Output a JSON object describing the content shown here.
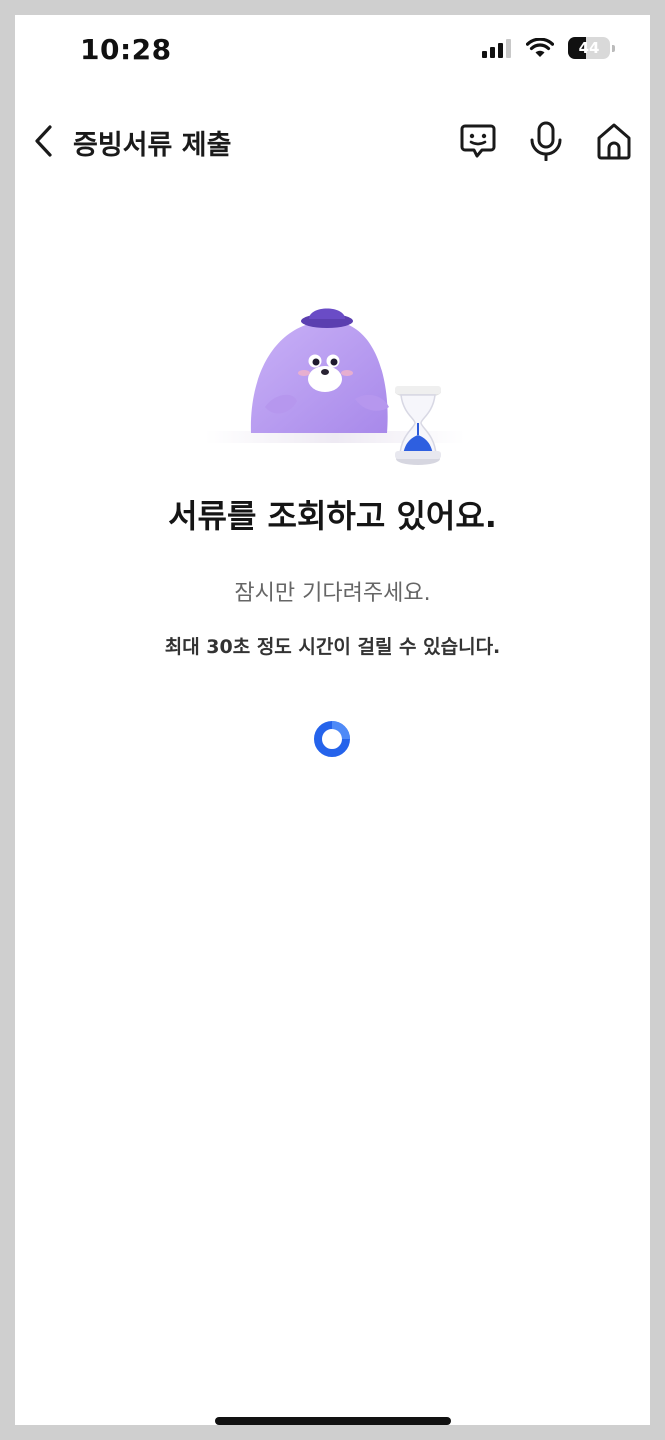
{
  "status_bar": {
    "time": "10:28",
    "battery_level": "44",
    "icons": [
      "signal-icon",
      "wifi-icon",
      "battery-icon"
    ]
  },
  "header": {
    "title": "증빙서류 제출",
    "icons": [
      "back-icon",
      "chat-bot-icon",
      "microphone-icon",
      "home-icon"
    ]
  },
  "main": {
    "title": "서류를 조회하고 있어요.",
    "subtitle": "잠시만 기다려주세요.",
    "note": "최대 30초 정도 시간이 걸릴 수 있습니다.",
    "spinner_color": "#2563eb",
    "mascot_color": "#b79cf2"
  }
}
